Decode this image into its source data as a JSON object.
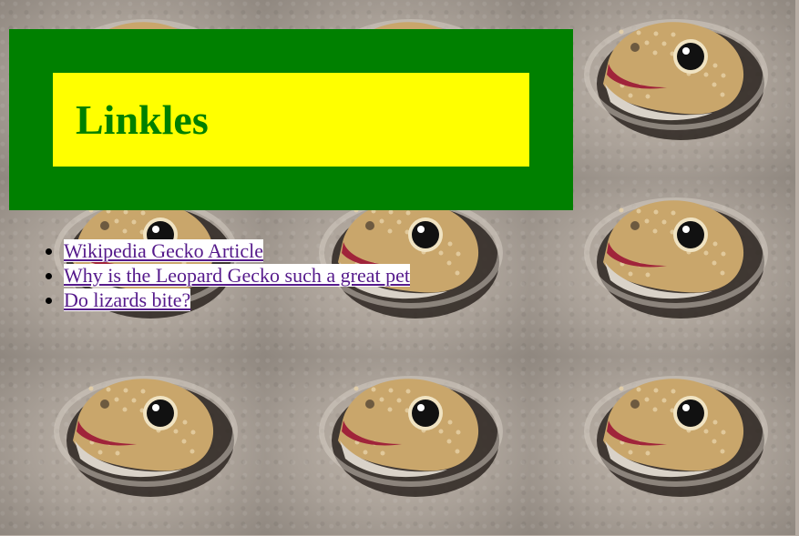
{
  "page": {
    "title": "Linkles",
    "header_color": "#008000",
    "title_bg_color": "#ffff00",
    "link_color": "#551a8b"
  },
  "background": {
    "image": "gecko-in-sand",
    "tiles": 9
  },
  "links": [
    {
      "label": "Wikipedia Gecko Article"
    },
    {
      "label": "Why is the Leopard Gecko such a great pet"
    },
    {
      "label": "Do lizards bite?"
    }
  ]
}
